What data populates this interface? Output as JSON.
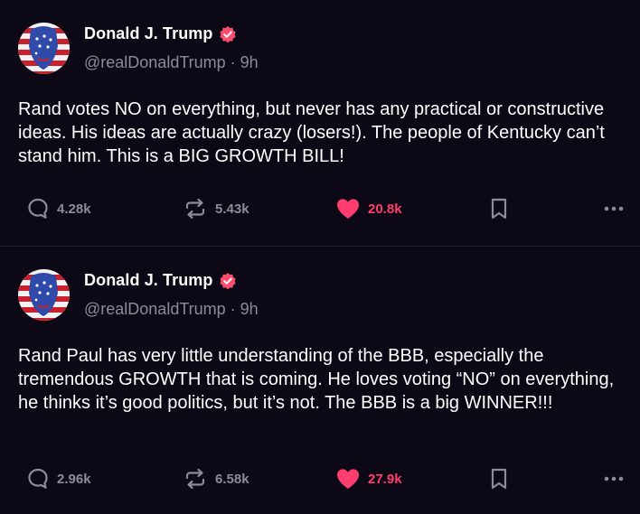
{
  "colors": {
    "background": "#0c0816",
    "text": "#ffffff",
    "muted": "#8d8a99",
    "like_accent": "#ff3d6e",
    "verified": "#ff4d6d"
  },
  "posts": [
    {
      "author_name": "Donald J. Trump",
      "handle": "@realDonaldTrump",
      "separator": "·",
      "time": "9h",
      "text": "Rand votes NO on everything, but never has any practical or constructive ideas. His ideas are actually crazy (losers!). The people of Kentucky can’t stand him. This is a BIG GROWTH BILL!",
      "replies": "4.28k",
      "reposts": "5.43k",
      "likes": "20.8k",
      "liked": true
    },
    {
      "author_name": "Donald J. Trump",
      "handle": "@realDonaldTrump",
      "separator": "·",
      "time": "9h",
      "text": "Rand Paul has very little understanding of the BBB, especially the tremendous GROWTH that is coming. He loves voting “NO” on everything, he thinks it’s good politics, but it’s not. The BBB is a big WINNER!!!",
      "replies": "2.96k",
      "reposts": "6.58k",
      "likes": "27.9k",
      "liked": true
    }
  ],
  "icons": {
    "avatar": "avatar-flag-portrait",
    "verified": "verified-badge-icon",
    "reply": "reply-bubble-icon",
    "repost": "repost-arrows-icon",
    "like": "heart-icon",
    "bookmark": "bookmark-icon",
    "more": "more-dots-icon"
  }
}
